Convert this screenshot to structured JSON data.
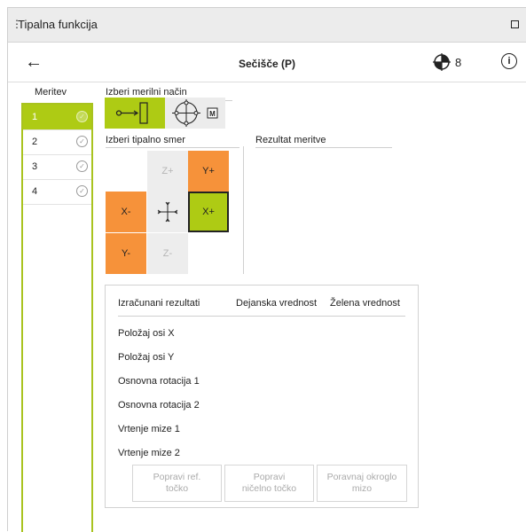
{
  "window": {
    "title": "Tipalna funkcija"
  },
  "header": {
    "title": "Sečišče (P)",
    "probe_number": "8"
  },
  "sidebar": {
    "heading": "Meritev",
    "items": [
      {
        "label": "1",
        "selected": true
      },
      {
        "label": "2",
        "selected": false
      },
      {
        "label": "3",
        "selected": false
      },
      {
        "label": "4",
        "selected": false
      }
    ]
  },
  "mode": {
    "heading": "Izberi merilni način",
    "m_label": "M"
  },
  "direction": {
    "heading": "Izberi tipalno smer",
    "zplus": "Z+",
    "yplus": "Y+",
    "xminus": "X-",
    "xplus": "X+",
    "yminus": "Y-",
    "zminus": "Z-"
  },
  "result": {
    "heading": "Rezultat meritve"
  },
  "calc": {
    "columns": [
      "Izračunani rezultati",
      "Dejanska vrednost",
      "Želena vrednost"
    ],
    "rows": [
      "Položaj osi X",
      "Položaj osi Y",
      "Osnovna rotacija 1",
      "Osnovna rotacija 2",
      "Vrtenje mize 1",
      "Vrtenje mize 2"
    ],
    "buttons": {
      "fix_ref_1": "Popravi ref.",
      "fix_ref_2": "točko",
      "fix_zero_1": "Popravi",
      "fix_zero_2": "ničelno točko",
      "align_table": "Poravnaj okroglo mizo"
    }
  },
  "colors": {
    "accent_green": "#aecb14",
    "accent_orange": "#f6923a"
  }
}
